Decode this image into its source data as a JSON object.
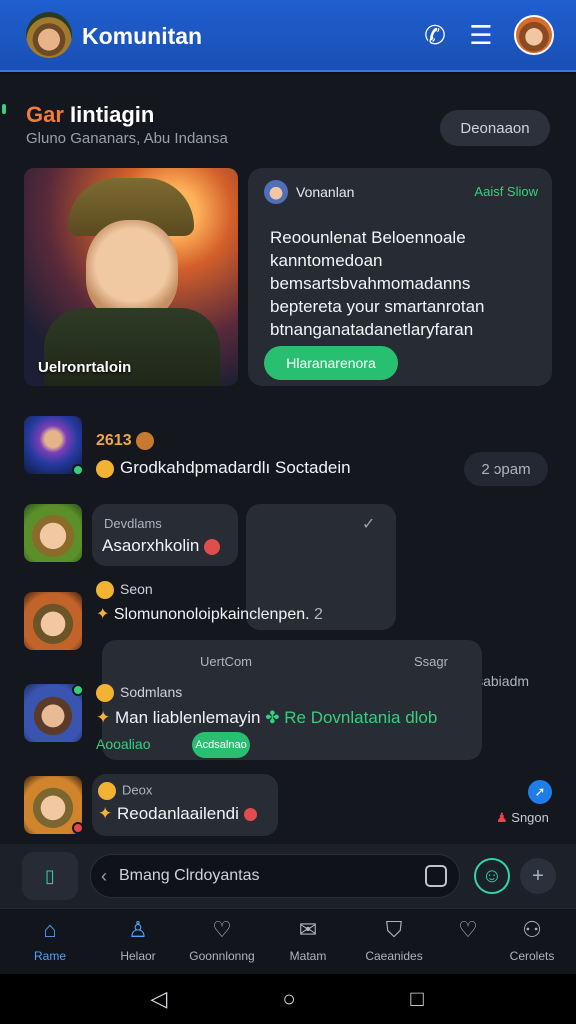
{
  "app": {
    "title": "Komunitan"
  },
  "hero": {
    "title_a": "Gar",
    "title_b": " Iintiagin",
    "subtitle": "Gluno Gananars, Abu Indansa",
    "button": "Deonaaon"
  },
  "feature": {
    "image_caption": "Uelronrtaloin",
    "author": "Vonanlan",
    "tag": "Aaisf Sliow",
    "body": "Reoounlenat Beloennoale kanntomedoan bemsartsbvahmomadanns beptereta your smartanrotan btnanganatadanetlaryfaran",
    "cta": "Hlaranarenora"
  },
  "feed": [
    {
      "meta": "2613",
      "line": "Grodkahdpmadardlı   Soctadein",
      "pill": "2 ɔpam"
    },
    {
      "label": "Devdlams",
      "line": "Asaorxhkolin"
    },
    {
      "meta": "Seon",
      "line": "Slomunonoloipkainclenpen.",
      "count": "2",
      "side_label": "Usabiadm"
    },
    {
      "label": "UertCom",
      "time": "Ssagr",
      "meta": "Sodmlans",
      "line_a": "Man liablenlemayin",
      "line_b": "Re Dovnlatania dlob",
      "line_c": "Aooaliao",
      "btn": "Acdsalnao"
    },
    {
      "meta": "Deox",
      "line": "Reodanlaailendi",
      "side_label": "Sngon"
    }
  ],
  "composer": {
    "placeholder": "Bmang Clrdoyantas"
  },
  "tabs": [
    {
      "label": "Rame"
    },
    {
      "label": "Helaor"
    },
    {
      "label": "Goonnlonng"
    },
    {
      "label": "Matam"
    },
    {
      "label": "Caeanides"
    },
    {
      "label": "Cerolets"
    }
  ]
}
